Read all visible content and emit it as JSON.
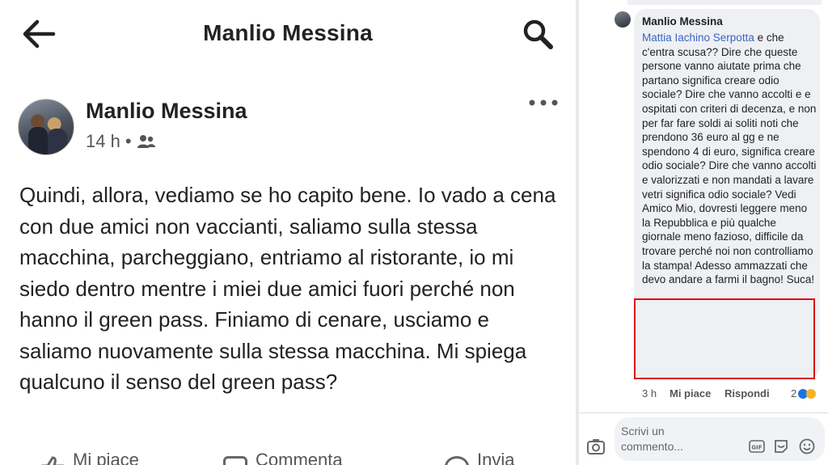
{
  "post_view": {
    "topbar": {
      "title": "Manlio Messina"
    },
    "post": {
      "author": "Manlio Messina",
      "time": "14 h",
      "separator": "•",
      "audience_icon": "friends-icon",
      "text": "Quindi, allora, vediamo se ho capito bene. Io vado a cena con due amici non vaccianti, saliamo sulla stessa macchina,  parcheggiano,  entriamo al ristorante, io mi siedo dentro mentre i miei due amici fuori perché non hanno il green pass. Finiamo di cenare, usciamo e saliamo nuovamente sulla stessa macchina. Mi spiega qualcuno il senso del green pass?"
    },
    "actions": {
      "like": "Mi piace",
      "comment": "Commenta",
      "share": "Invia"
    }
  },
  "comment_view": {
    "comment": {
      "author": "Manlio Messina",
      "mention": "Mattia Iachino Serpotta",
      "text_before_highlight": " e che c'entra scusa?? Dire che queste persone vanno aiutate prima che partano significa creare odio sociale? Dire che vanno accolti e e ospitati con criteri di decenza, e non per far fare soldi ai soliti noti che prendono 36 euro al gg e ne spendono 4 di euro, significa creare odio sociale? Dire che vanno accolti e valorizzati e non mandati a lavare vetri significa odio sociale? Vedi Amico Mio, dovresti leggere meno la Repubblica e più qualche giornale meno fazioso, ",
      "text_highlight": "difficile da trovare perché noi non controlliamo la stampa! Adesso ammazzati che devo andare a farmi il bagno! Suca!",
      "time": "3 h",
      "like": "Mi piace",
      "reply": "Rispondi",
      "reactions_count": "2"
    },
    "composer": {
      "placeholder": "Scrivi un commento..."
    }
  }
}
